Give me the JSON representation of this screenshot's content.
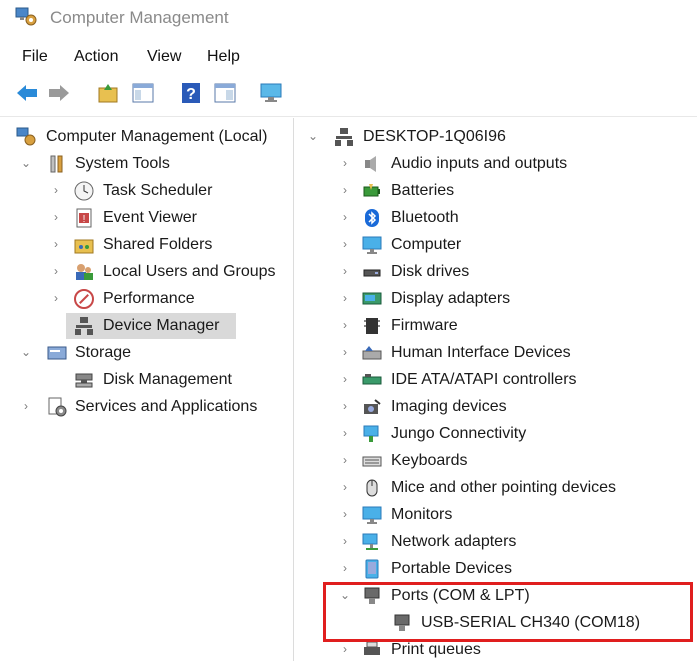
{
  "window": {
    "title": "Computer Management"
  },
  "menu": [
    "File",
    "Action",
    "View",
    "Help"
  ],
  "left_tree": {
    "root": "Computer Management (Local)",
    "system_tools": "System Tools",
    "task_scheduler": "Task Scheduler",
    "event_viewer": "Event Viewer",
    "shared_folders": "Shared Folders",
    "local_users": "Local Users and Groups",
    "performance": "Performance",
    "device_manager": "Device Manager",
    "storage": "Storage",
    "disk_management": "Disk Management",
    "services": "Services and Applications"
  },
  "device_tree": {
    "computer_name": "DESKTOP-1Q06I96",
    "categories": [
      {
        "label": "Audio inputs and outputs",
        "icon": "speaker-icon"
      },
      {
        "label": "Batteries",
        "icon": "battery-icon"
      },
      {
        "label": "Bluetooth",
        "icon": "bluetooth-icon"
      },
      {
        "label": "Computer",
        "icon": "monitor-icon"
      },
      {
        "label": "Disk drives",
        "icon": "disk-drive-icon"
      },
      {
        "label": "Display adapters",
        "icon": "display-adapter-icon"
      },
      {
        "label": "Firmware",
        "icon": "firmware-icon"
      },
      {
        "label": "Human Interface Devices",
        "icon": "hid-icon"
      },
      {
        "label": "IDE ATA/ATAPI controllers",
        "icon": "ide-controller-icon"
      },
      {
        "label": "Imaging devices",
        "icon": "camera-icon"
      },
      {
        "label": "Jungo Connectivity",
        "icon": "network-icon"
      },
      {
        "label": "Keyboards",
        "icon": "keyboard-icon"
      },
      {
        "label": "Mice and other pointing devices",
        "icon": "mouse-icon"
      },
      {
        "label": "Monitors",
        "icon": "monitor-icon"
      },
      {
        "label": "Network adapters",
        "icon": "network-adapter-icon"
      },
      {
        "label": "Portable Devices",
        "icon": "portable-device-icon"
      },
      {
        "label": "Ports (COM & LPT)",
        "icon": "port-icon"
      }
    ],
    "port_child": "USB-SERIAL CH340 (COM18)",
    "print_queues": "Print queues"
  },
  "colors": {
    "highlight_box": "#e01e1e",
    "selected_row": "#d9d9d9"
  }
}
